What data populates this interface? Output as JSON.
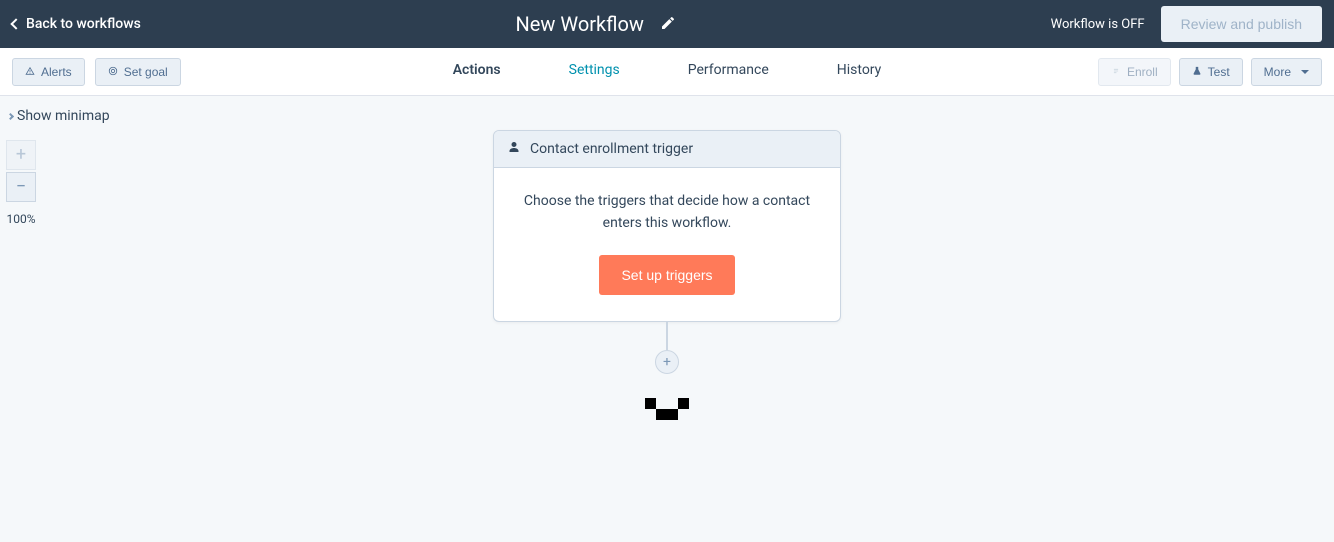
{
  "header": {
    "back_label": "Back to workflows",
    "title": "New Workflow",
    "status_text": "Workflow is OFF",
    "publish_label": "Review and publish"
  },
  "subnav": {
    "alerts_label": "Alerts",
    "set_goal_label": "Set goal",
    "tabs": {
      "actions": "Actions",
      "settings": "Settings",
      "performance": "Performance",
      "history": "History"
    },
    "enroll_label": "Enroll",
    "test_label": "Test",
    "more_label": "More"
  },
  "canvas": {
    "minimap_label": "Show minimap",
    "zoom_level": "100%",
    "trigger_card": {
      "title": "Contact enrollment trigger",
      "body": "Choose the triggers that decide how a contact enters this workflow.",
      "button": "Set up triggers"
    }
  }
}
